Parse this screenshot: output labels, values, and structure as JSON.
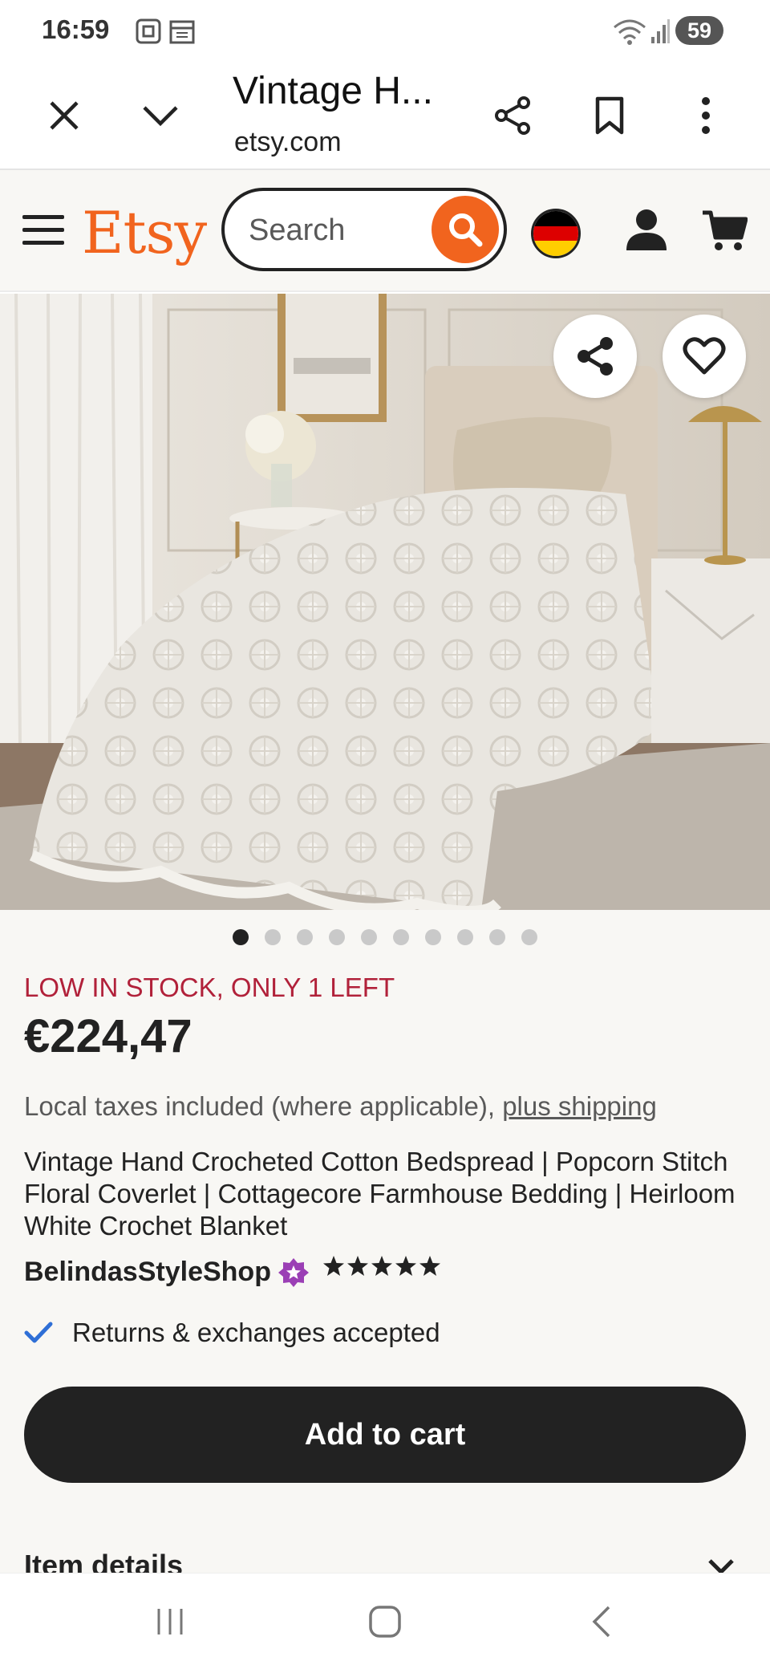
{
  "status_bar": {
    "time": "16:59",
    "battery": "59",
    "icons": [
      "screenshot-icon",
      "calendar-icon",
      "wifi-icon",
      "signal-icon"
    ]
  },
  "browser": {
    "tab_title": "Vintage H...",
    "url": "etsy.com",
    "icons": [
      "close-icon",
      "chevron-down-icon",
      "share-icon",
      "bookmark-icon",
      "more-icon"
    ]
  },
  "header": {
    "logo": "Etsy",
    "search_placeholder": "Search",
    "brand_color": "#f1641e",
    "flag_colors": [
      "#000000",
      "#dd0000",
      "#ffce00"
    ]
  },
  "product": {
    "image_subject": "white crochet bedspread on single bed",
    "image_count": 10,
    "active_image": 1,
    "stock_notice": "LOW IN STOCK, ONLY 1 LEFT",
    "price": "€224,47",
    "taxes_text": "Local taxes included (where applicable), ",
    "shipping_link": "plus shipping",
    "title": "Vintage Hand Crocheted Cotton Bedspread | Popcorn Stitch Floral Coverlet | Cottagecore Farmhouse Bedding | Heirloom White Crochet Blanket",
    "shop_name": "BelindasStyleShop",
    "rating_stars": 5,
    "returns_text": "Returns & exchanges accepted",
    "add_to_cart": "Add to cart",
    "item_details": "Item details"
  },
  "colors": {
    "stock_red": "#b1213a",
    "button_dark": "#222222",
    "check_blue": "#2f6fd6",
    "star_seller_purple": "#9b3fb5"
  }
}
